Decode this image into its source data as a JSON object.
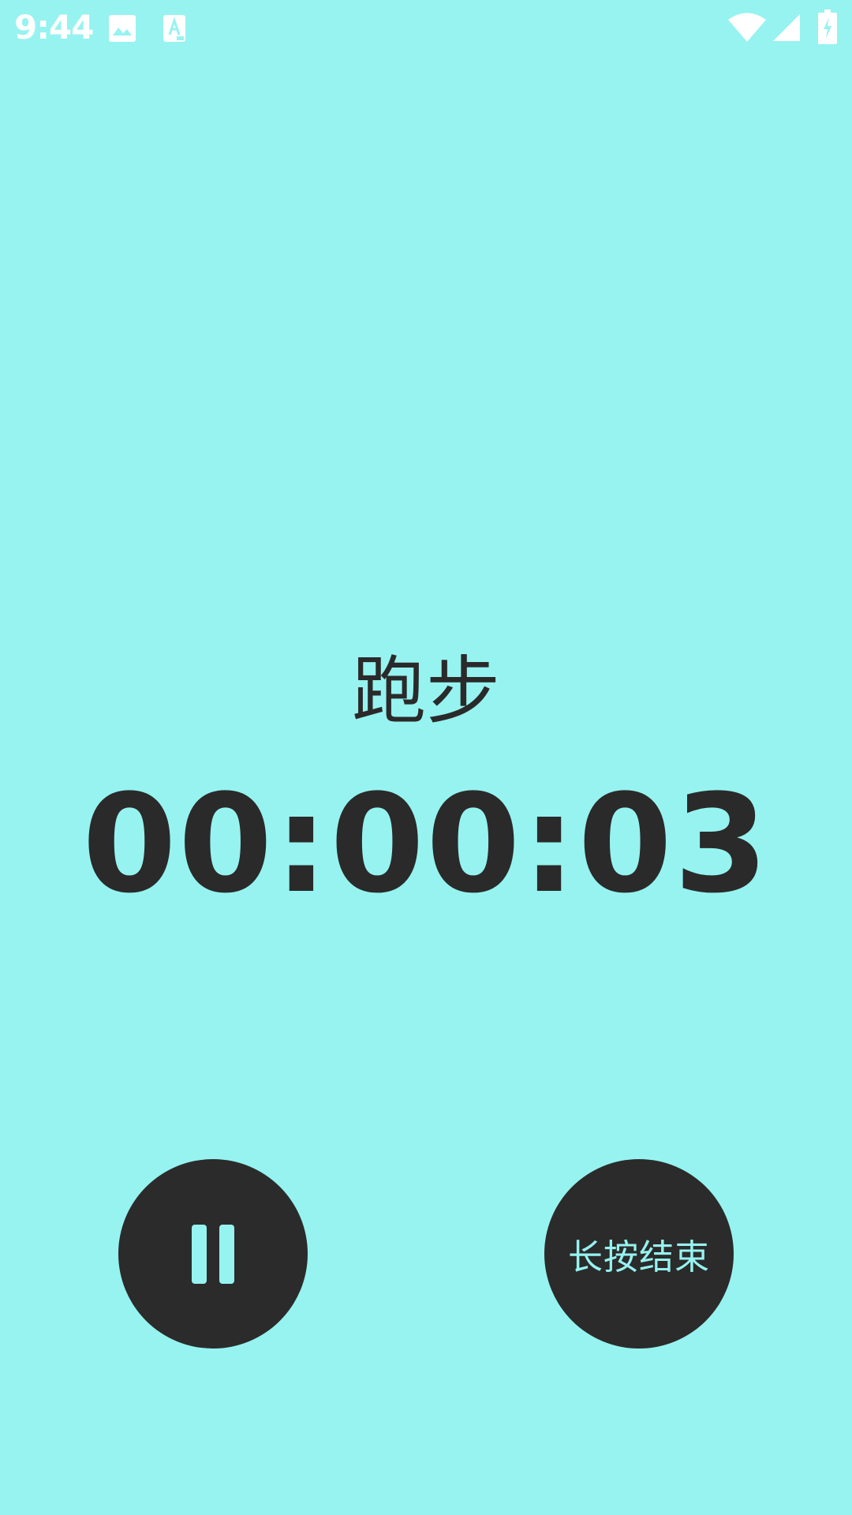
{
  "status_bar": {
    "time": "9:44",
    "icons": [
      "image-notification-icon",
      "font-notification-icon",
      "wifi-icon",
      "cell-signal-icon",
      "battery-charging-icon"
    ]
  },
  "activity": {
    "title": "跑步",
    "timer": "00:00:03"
  },
  "controls": {
    "pause_icon": "pause-icon",
    "end_label": "长按结束"
  },
  "colors": {
    "background": "#96f3f0",
    "button": "#2b2b2b",
    "text_dark": "#2a2a2a",
    "status_icons": "#ffffff"
  }
}
